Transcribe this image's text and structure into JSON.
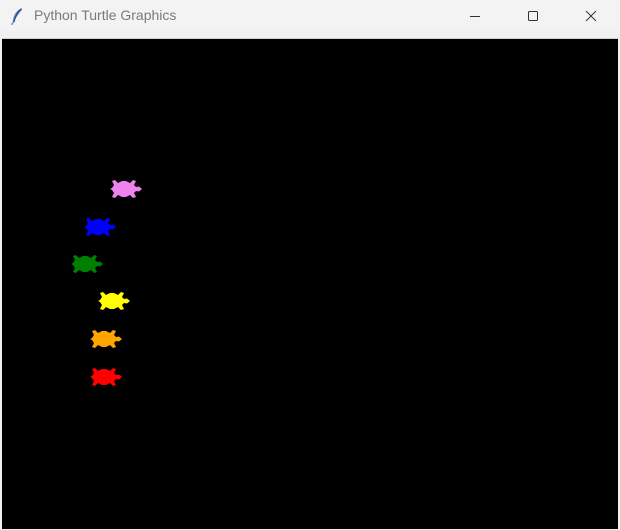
{
  "window": {
    "title": "Python Turtle Graphics",
    "icon": "feather-icon",
    "controls": [
      "minimize-icon",
      "maximize-icon",
      "close-icon"
    ]
  },
  "canvas": {
    "background": "#000000",
    "turtles": [
      {
        "color": "#ee82ee",
        "name": "violet"
      },
      {
        "color": "#0000ff",
        "name": "blue"
      },
      {
        "color": "#008000",
        "name": "green"
      },
      {
        "color": "#ffff00",
        "name": "yellow"
      },
      {
        "color": "#ffa500",
        "name": "orange"
      },
      {
        "color": "#ff0000",
        "name": "red"
      }
    ]
  }
}
